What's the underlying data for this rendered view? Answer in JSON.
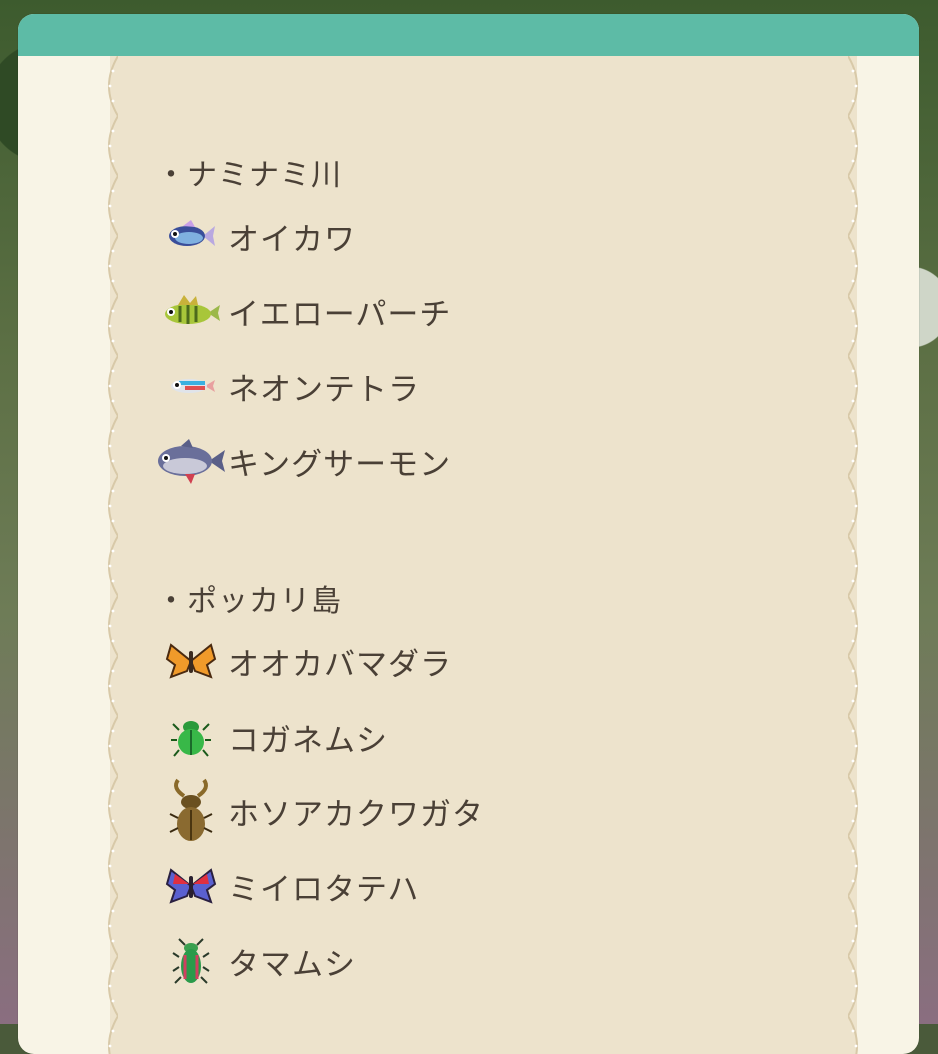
{
  "sections": [
    {
      "title": "・ナミナミ川",
      "items": [
        {
          "label": "オイカワ",
          "icon": "pale-chub-fish-icon"
        },
        {
          "label": "イエローパーチ",
          "icon": "yellow-perch-fish-icon"
        },
        {
          "label": "ネオンテトラ",
          "icon": "neon-tetra-fish-icon"
        },
        {
          "label": "キングサーモン",
          "icon": "king-salmon-fish-icon"
        }
      ]
    },
    {
      "title": "・ポッカリ島",
      "items": [
        {
          "label": "オオカバマダラ",
          "icon": "monarch-butterfly-icon"
        },
        {
          "label": "コガネムシ",
          "icon": "scarab-beetle-icon"
        },
        {
          "label": "ホソアカクワガタ",
          "icon": "stag-beetle-icon"
        },
        {
          "label": "ミイロタテハ",
          "icon": "agrias-butterfly-icon"
        },
        {
          "label": "タマムシ",
          "icon": "jewel-beetle-icon"
        }
      ]
    }
  ],
  "colors": {
    "header": "#5dbba6",
    "panel": "#f8f4e6",
    "paper": "#ede3cc",
    "text": "#4a4036"
  }
}
